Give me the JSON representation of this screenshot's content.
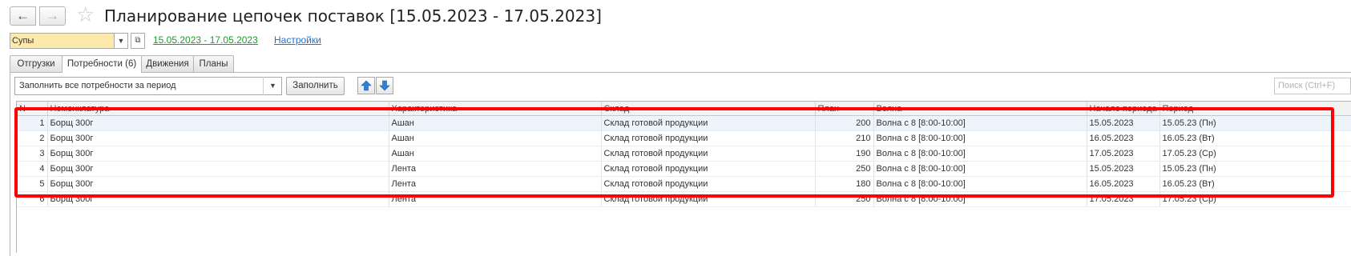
{
  "window": {
    "title": "Планирование цепочек поставок [15.05.2023 - 17.05.2023]",
    "back_icon": "arrow-left",
    "forward_icon": "arrow-right",
    "favorite_icon": "star"
  },
  "filter": {
    "product_group": "Супы",
    "period_link": "15.05.2023 - 17.05.2023",
    "settings_link": "Настройки"
  },
  "tabs": [
    {
      "label": "Отгрузки",
      "active": false
    },
    {
      "label": "Потребности (6)",
      "active": true
    },
    {
      "label": "Движения",
      "active": false
    },
    {
      "label": "Планы",
      "active": false
    }
  ],
  "toolbar": {
    "fill_mode_value": "Заполнить все потребности за период",
    "fill_button": "Заполнить",
    "move_up_icon": "arrow-up",
    "move_down_icon": "arrow-down",
    "search_placeholder": "Поиск (Ctrl+F)"
  },
  "table": {
    "columns": [
      "N",
      "Номенклатура",
      "Характеристика",
      "Склад",
      "План",
      "Волна",
      "Начало периода",
      "Период"
    ],
    "rows": [
      {
        "n": "1",
        "item": "Борщ 300г",
        "characteristic": "Ашан",
        "warehouse": "Склад готовой продукции",
        "plan": "200",
        "wave": "Волна с 8 [8:00-10:00]",
        "start": "15.05.2023",
        "period": "15.05.23 (Пн)"
      },
      {
        "n": "2",
        "item": "Борщ 300г",
        "characteristic": "Ашан",
        "warehouse": "Склад готовой продукции",
        "plan": "210",
        "wave": "Волна с 8 [8:00-10:00]",
        "start": "16.05.2023",
        "period": "16.05.23 (Вт)"
      },
      {
        "n": "3",
        "item": "Борщ 300г",
        "characteristic": "Ашан",
        "warehouse": "Склад готовой продукции",
        "plan": "190",
        "wave": "Волна с 8 [8:00-10:00]",
        "start": "17.05.2023",
        "period": "17.05.23 (Ср)"
      },
      {
        "n": "4",
        "item": "Борщ 300г",
        "characteristic": "Лента",
        "warehouse": "Склад готовой продукции",
        "plan": "250",
        "wave": "Волна с 8 [8:00-10:00]",
        "start": "15.05.2023",
        "period": "15.05.23 (Пн)"
      },
      {
        "n": "5",
        "item": "Борщ 300г",
        "characteristic": "Лента",
        "warehouse": "Склад готовой продукции",
        "plan": "180",
        "wave": "Волна с 8 [8:00-10:00]",
        "start": "16.05.2023",
        "period": "16.05.23 (Вт)"
      },
      {
        "n": "6",
        "item": "Борщ 300г",
        "characteristic": "Лента",
        "warehouse": "Склад готовой продукции",
        "plan": "250",
        "wave": "Волна с 8 [8:00-10:00]",
        "start": "17.05.2023",
        "period": "17.05.23 (Ср)"
      }
    ]
  },
  "colors": {
    "highlight": "#ff0000",
    "period_link": "#1a9e2a",
    "settings_link": "#2a6fc9",
    "combo_background": "#fde9ac",
    "arrow_buttons": "#2f7fd6"
  }
}
